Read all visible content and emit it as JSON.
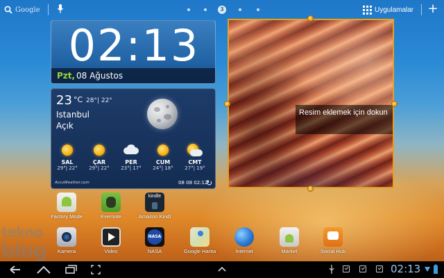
{
  "topbar": {
    "search_label": "Google",
    "current_page": "3",
    "apps_label": "Uygulamalar",
    "add_label": "+"
  },
  "clock": {
    "time": "02:13",
    "day": "Pzt,",
    "date": "08 Ağustos"
  },
  "weather": {
    "temp": "23",
    "unit": "°C",
    "hilo": "28°| 22°",
    "city": "Istanbul",
    "condition": "Açık",
    "icon": "moon-clear-night-icon",
    "forecast": [
      {
        "day": "SAL",
        "range": "29°| 22°",
        "icon": "sun-icon"
      },
      {
        "day": "ÇAR",
        "range": "29°| 22°",
        "icon": "sun-icon"
      },
      {
        "day": "PER",
        "range": "23°| 17°",
        "icon": "cloud-icon"
      },
      {
        "day": "CUM",
        "range": "24°| 18°",
        "icon": "sun-icon"
      },
      {
        "day": "CMT",
        "range": "27°| 19°",
        "icon": "partly-cloudy-icon"
      }
    ],
    "brand": "AccuWeather.com",
    "updated": "08 08 02:12"
  },
  "photo_frame": {
    "caption": "Resim eklemek için dokun",
    "frame_color": "#e8a020"
  },
  "apps_row1": [
    {
      "label": "Factory Mode",
      "icon": "factory-mode-icon"
    },
    {
      "label": "Evernote",
      "icon": "evernote-icon"
    },
    {
      "label": "Amazon Kindl",
      "icon": "kindle-icon",
      "icon_text": "kindle"
    }
  ],
  "apps_row2": [
    {
      "label": "Kamera",
      "icon": "camera-icon"
    },
    {
      "label": "Video",
      "icon": "video-icon"
    },
    {
      "label": "NASA",
      "icon": "nasa-icon",
      "icon_text": "NASA"
    },
    {
      "label": "Google Harita",
      "icon": "maps-icon"
    },
    {
      "label": "İnternet",
      "icon": "internet-globe-icon"
    },
    {
      "label": "Market",
      "icon": "market-icon"
    },
    {
      "label": "Social Hub",
      "icon": "social-hub-icon"
    }
  ],
  "watermark": {
    "line1": "tekno",
    "line2": "blog"
  },
  "system_bar": {
    "time": "02:13",
    "nav": [
      "back-icon",
      "home-icon",
      "recent-apps-icon",
      "screenshot-icon"
    ]
  },
  "colors": {
    "accent_green": "#9bd33a",
    "clock_blue": "#2366a8",
    "status_blue": "#9cc8ee"
  }
}
